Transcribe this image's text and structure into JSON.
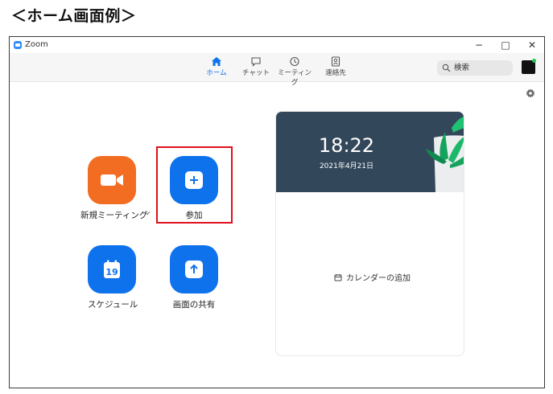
{
  "page": {
    "heading": "＜ホーム画面例＞"
  },
  "window": {
    "title": "Zoom",
    "controls": {
      "minimize": "−",
      "maximize": "□",
      "close": "✕"
    }
  },
  "nav": {
    "items": [
      {
        "label": "ホーム",
        "icon": "home-icon",
        "active": true
      },
      {
        "label": "チャット",
        "icon": "chat-icon"
      },
      {
        "label": "ミーティング",
        "icon": "clock-icon"
      },
      {
        "label": "連絡先",
        "icon": "contacts-icon"
      }
    ],
    "search": {
      "placeholder": "検索"
    }
  },
  "actions": {
    "new_meeting": "新規ミーティング",
    "join": "参加",
    "schedule": "スケジュール",
    "schedule_day": "19",
    "share_screen": "画面の共有"
  },
  "card": {
    "time": "18:22",
    "date": "2021年4月21日",
    "add_calendar": "カレンダーの追加"
  },
  "colors": {
    "accent_blue": "#0e72ed",
    "orange": "#f26d21",
    "highlight_red": "#e0101a",
    "card_header": "#33475a"
  }
}
